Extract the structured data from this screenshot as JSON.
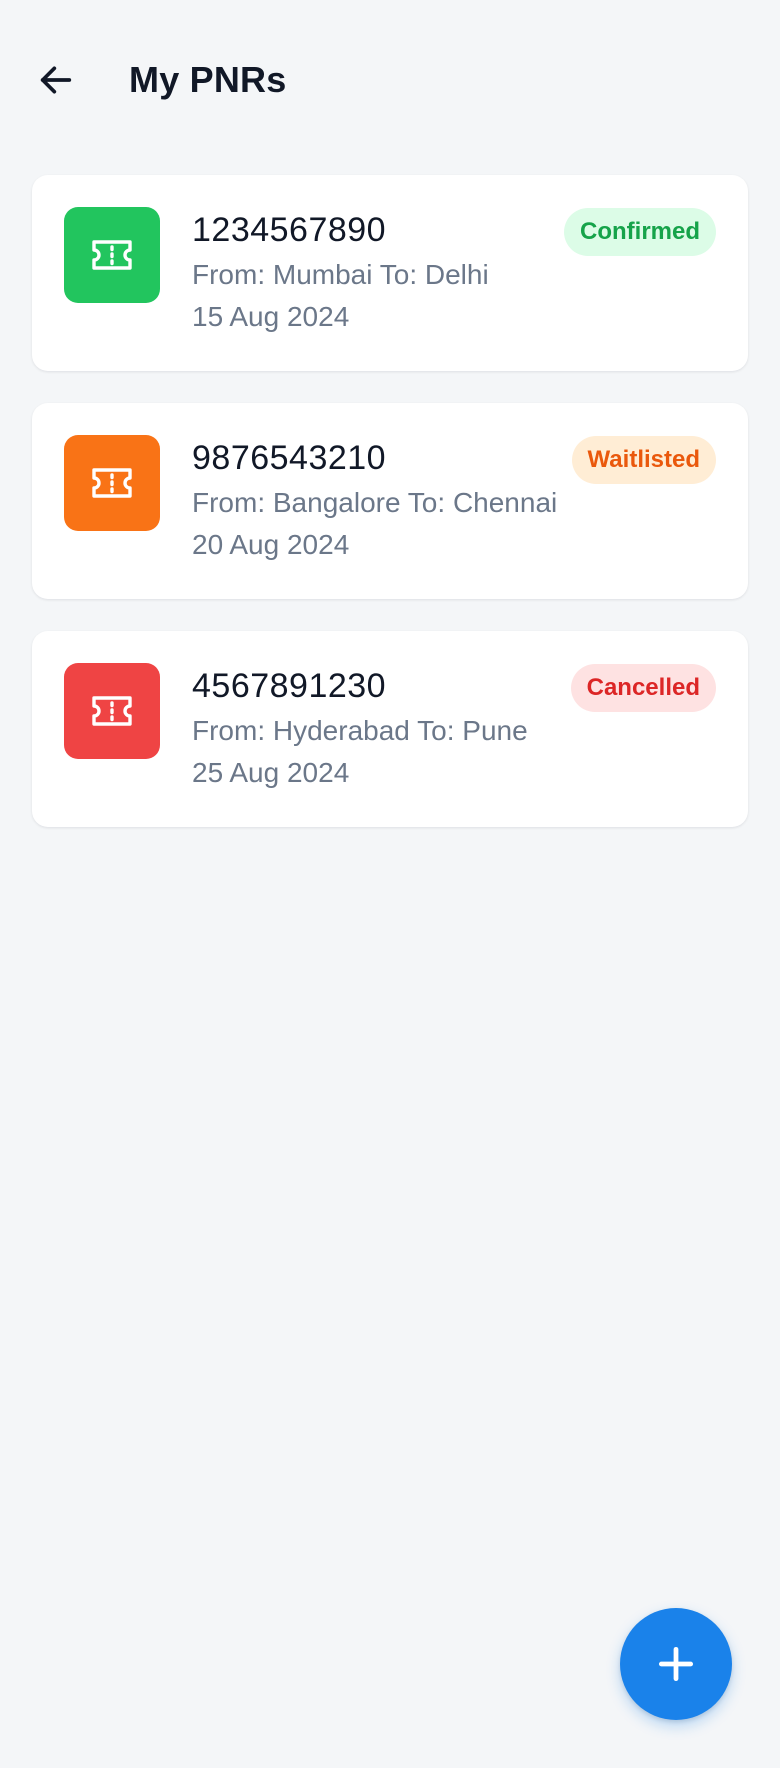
{
  "header": {
    "title": "My PNRs",
    "back_icon": "arrow-left-icon"
  },
  "pnrs": [
    {
      "number": "1234567890",
      "route": "From: Mumbai To: Delhi",
      "date": "15 Aug 2024",
      "status": "Confirmed",
      "icon": "ticket-icon",
      "icon_bg": "#22c55e",
      "badge_bg": "#dcfce7",
      "badge_fg": "#16a34a"
    },
    {
      "number": "9876543210",
      "route": "From: Bangalore To: Chennai",
      "date": "20 Aug 2024",
      "status": "Waitlisted",
      "icon": "ticket-icon",
      "icon_bg": "#f97316",
      "badge_bg": "#ffedd5",
      "badge_fg": "#ea580c"
    },
    {
      "number": "4567891230",
      "route": "From: Hyderabad To: Pune",
      "date": "25 Aug 2024",
      "status": "Cancelled",
      "icon": "ticket-icon",
      "icon_bg": "#ef4444",
      "badge_bg": "#fee2e2",
      "badge_fg": "#dc2626"
    }
  ],
  "fab": {
    "icon": "plus-icon",
    "color": "#1a82ea"
  }
}
